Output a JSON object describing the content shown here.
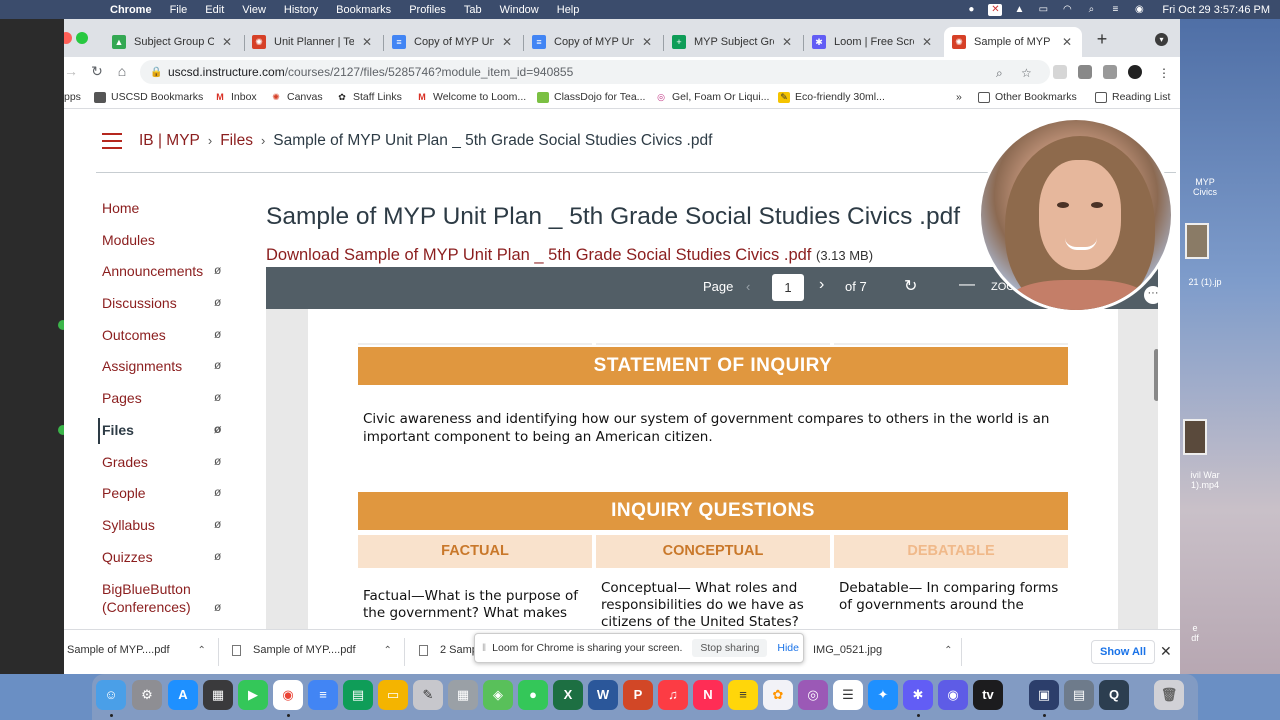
{
  "menubar": {
    "app": "Chrome",
    "menus": [
      "File",
      "Edit",
      "View",
      "History",
      "Bookmarks",
      "Profiles",
      "Tab",
      "Window",
      "Help"
    ],
    "clock": "Fri Oct 29  3:57:46 PM"
  },
  "tabs": [
    {
      "label": "Subject Group Ove",
      "icon": "google-drive-icon",
      "color": "#34a853"
    },
    {
      "label": "Unit Planner | Temp",
      "icon": "canvas-icon",
      "color": "#d64027"
    },
    {
      "label": "Copy of MYP Unit P",
      "icon": "google-docs-icon",
      "color": "#4285f4"
    },
    {
      "label": "Copy of MYP Unit P",
      "icon": "google-docs-icon",
      "color": "#4285f4"
    },
    {
      "label": "MYP Subject Group",
      "icon": "google-sheets-icon",
      "color": "#0f9d58"
    },
    {
      "label": "Loom | Free Screen",
      "icon": "loom-icon",
      "color": "#625df5"
    },
    {
      "label": "Sample of MYP Uni",
      "icon": "canvas-icon",
      "color": "#d64027",
      "active": true
    }
  ],
  "address": {
    "host": "uscsd.instructure.com",
    "path": "/courses/2127/files/5285746?module_item_id=940855"
  },
  "bookmarks": {
    "items": [
      "pps",
      "USCSD Bookmarks",
      "Inbox",
      "Canvas",
      "Staff Links",
      "Welcome to Loom...",
      "ClassDojo for Tea...",
      "Gel, Foam Or Liqui...",
      "Eco-friendly 30ml..."
    ],
    "more": "»",
    "other": "Other Bookmarks",
    "reading": "Reading List"
  },
  "breadcrumb": {
    "course": "IB | MYP",
    "section": "Files",
    "current": "Sample of MYP Unit Plan _ 5th Grade Social Studies Civics .pdf"
  },
  "course_nav": {
    "items": [
      {
        "label": "Home",
        "hidden": false
      },
      {
        "label": "Modules",
        "hidden": false
      },
      {
        "label": "Announcements",
        "hidden": true
      },
      {
        "label": "Discussions",
        "hidden": true
      },
      {
        "label": "Outcomes",
        "hidden": true
      },
      {
        "label": "Assignments",
        "hidden": true
      },
      {
        "label": "Pages",
        "hidden": true
      },
      {
        "label": "Files",
        "hidden": true,
        "active": true
      },
      {
        "label": "Grades",
        "hidden": true
      },
      {
        "label": "People",
        "hidden": true
      },
      {
        "label": "Syllabus",
        "hidden": true
      },
      {
        "label": "Quizzes",
        "hidden": true
      },
      {
        "label": "BigBlueButton (Conferences)",
        "hidden": true
      }
    ]
  },
  "file": {
    "title": "Sample of MYP Unit Plan _ 5th Grade Social Studies Civics .pdf",
    "download_label": "Download Sample of MYP Unit Plan _ 5th Grade Social Studies Civics .pdf",
    "size": "(3.13 MB)"
  },
  "viewer": {
    "page_label": "Page",
    "page_value": "1",
    "of_label": "of 7",
    "zoom_label": "ZOO"
  },
  "pdf": {
    "statement_heading": "STATEMENT OF INQUIRY",
    "statement_text": " Civic awareness and identifying how our system of government compares to others in the world is an important component to being an American citizen.",
    "questions_heading": "INQUIRY QUESTIONS",
    "columns": [
      {
        "heading": "FACTUAL",
        "text": "Factual—What is the purpose of the government?  What makes"
      },
      {
        "heading": "CONCEPTUAL",
        "text": "Conceptual— What roles and responsibilities do we have as citizens of the United States?"
      },
      {
        "heading": "DEBATABLE",
        "text": "Debatable— In comparing forms of governments around the"
      }
    ]
  },
  "downloads": [
    {
      "name": "Sample of MYP....pdf"
    },
    {
      "name": "Sample of MYP....pdf"
    },
    {
      "name": "2 Samp"
    },
    {
      "name": "IMG_0521.jpg"
    }
  ],
  "shelf": {
    "show_all": "Show All"
  },
  "share_bar": {
    "message": "Loom for Chrome is sharing your screen.",
    "stop": "Stop sharing",
    "hide": "Hide"
  },
  "desktop": {
    "files": [
      "MYP\nCivics",
      "21 (1).jp",
      "ivil War\n1).mp4",
      "e\ndf"
    ]
  },
  "dock": {
    "apps": [
      "Finder",
      "System Preferences",
      "App Store",
      "Calculator",
      "FaceTime",
      "Chrome",
      "Google Docs",
      "Google Sheets",
      "Google Slides",
      "Script Editor",
      "Launchpad",
      "Maps",
      "Messages",
      "Excel",
      "Word",
      "PowerPoint",
      "Music",
      "News",
      "Notes",
      "Photos",
      "Podcasts",
      "Reminders",
      "Safari",
      "Loom",
      "Siri",
      "TV",
      "Screen Sharing",
      "Image Capture",
      "QuickTime",
      "Trash"
    ]
  }
}
